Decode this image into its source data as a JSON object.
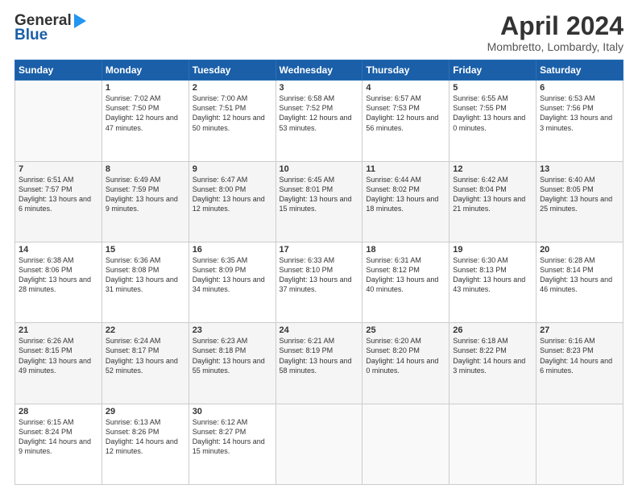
{
  "header": {
    "logo_general": "General",
    "logo_blue": "Blue",
    "month_title": "April 2024",
    "location": "Mombretto, Lombardy, Italy"
  },
  "weekdays": [
    "Sunday",
    "Monday",
    "Tuesday",
    "Wednesday",
    "Thursday",
    "Friday",
    "Saturday"
  ],
  "weeks": [
    [
      {
        "day": "",
        "sunrise": "",
        "sunset": "",
        "daylight": ""
      },
      {
        "day": "1",
        "sunrise": "Sunrise: 7:02 AM",
        "sunset": "Sunset: 7:50 PM",
        "daylight": "Daylight: 12 hours and 47 minutes."
      },
      {
        "day": "2",
        "sunrise": "Sunrise: 7:00 AM",
        "sunset": "Sunset: 7:51 PM",
        "daylight": "Daylight: 12 hours and 50 minutes."
      },
      {
        "day": "3",
        "sunrise": "Sunrise: 6:58 AM",
        "sunset": "Sunset: 7:52 PM",
        "daylight": "Daylight: 12 hours and 53 minutes."
      },
      {
        "day": "4",
        "sunrise": "Sunrise: 6:57 AM",
        "sunset": "Sunset: 7:53 PM",
        "daylight": "Daylight: 12 hours and 56 minutes."
      },
      {
        "day": "5",
        "sunrise": "Sunrise: 6:55 AM",
        "sunset": "Sunset: 7:55 PM",
        "daylight": "Daylight: 13 hours and 0 minutes."
      },
      {
        "day": "6",
        "sunrise": "Sunrise: 6:53 AM",
        "sunset": "Sunset: 7:56 PM",
        "daylight": "Daylight: 13 hours and 3 minutes."
      }
    ],
    [
      {
        "day": "7",
        "sunrise": "Sunrise: 6:51 AM",
        "sunset": "Sunset: 7:57 PM",
        "daylight": "Daylight: 13 hours and 6 minutes."
      },
      {
        "day": "8",
        "sunrise": "Sunrise: 6:49 AM",
        "sunset": "Sunset: 7:59 PM",
        "daylight": "Daylight: 13 hours and 9 minutes."
      },
      {
        "day": "9",
        "sunrise": "Sunrise: 6:47 AM",
        "sunset": "Sunset: 8:00 PM",
        "daylight": "Daylight: 13 hours and 12 minutes."
      },
      {
        "day": "10",
        "sunrise": "Sunrise: 6:45 AM",
        "sunset": "Sunset: 8:01 PM",
        "daylight": "Daylight: 13 hours and 15 minutes."
      },
      {
        "day": "11",
        "sunrise": "Sunrise: 6:44 AM",
        "sunset": "Sunset: 8:02 PM",
        "daylight": "Daylight: 13 hours and 18 minutes."
      },
      {
        "day": "12",
        "sunrise": "Sunrise: 6:42 AM",
        "sunset": "Sunset: 8:04 PM",
        "daylight": "Daylight: 13 hours and 21 minutes."
      },
      {
        "day": "13",
        "sunrise": "Sunrise: 6:40 AM",
        "sunset": "Sunset: 8:05 PM",
        "daylight": "Daylight: 13 hours and 25 minutes."
      }
    ],
    [
      {
        "day": "14",
        "sunrise": "Sunrise: 6:38 AM",
        "sunset": "Sunset: 8:06 PM",
        "daylight": "Daylight: 13 hours and 28 minutes."
      },
      {
        "day": "15",
        "sunrise": "Sunrise: 6:36 AM",
        "sunset": "Sunset: 8:08 PM",
        "daylight": "Daylight: 13 hours and 31 minutes."
      },
      {
        "day": "16",
        "sunrise": "Sunrise: 6:35 AM",
        "sunset": "Sunset: 8:09 PM",
        "daylight": "Daylight: 13 hours and 34 minutes."
      },
      {
        "day": "17",
        "sunrise": "Sunrise: 6:33 AM",
        "sunset": "Sunset: 8:10 PM",
        "daylight": "Daylight: 13 hours and 37 minutes."
      },
      {
        "day": "18",
        "sunrise": "Sunrise: 6:31 AM",
        "sunset": "Sunset: 8:12 PM",
        "daylight": "Daylight: 13 hours and 40 minutes."
      },
      {
        "day": "19",
        "sunrise": "Sunrise: 6:30 AM",
        "sunset": "Sunset: 8:13 PM",
        "daylight": "Daylight: 13 hours and 43 minutes."
      },
      {
        "day": "20",
        "sunrise": "Sunrise: 6:28 AM",
        "sunset": "Sunset: 8:14 PM",
        "daylight": "Daylight: 13 hours and 46 minutes."
      }
    ],
    [
      {
        "day": "21",
        "sunrise": "Sunrise: 6:26 AM",
        "sunset": "Sunset: 8:15 PM",
        "daylight": "Daylight: 13 hours and 49 minutes."
      },
      {
        "day": "22",
        "sunrise": "Sunrise: 6:24 AM",
        "sunset": "Sunset: 8:17 PM",
        "daylight": "Daylight: 13 hours and 52 minutes."
      },
      {
        "day": "23",
        "sunrise": "Sunrise: 6:23 AM",
        "sunset": "Sunset: 8:18 PM",
        "daylight": "Daylight: 13 hours and 55 minutes."
      },
      {
        "day": "24",
        "sunrise": "Sunrise: 6:21 AM",
        "sunset": "Sunset: 8:19 PM",
        "daylight": "Daylight: 13 hours and 58 minutes."
      },
      {
        "day": "25",
        "sunrise": "Sunrise: 6:20 AM",
        "sunset": "Sunset: 8:20 PM",
        "daylight": "Daylight: 14 hours and 0 minutes."
      },
      {
        "day": "26",
        "sunrise": "Sunrise: 6:18 AM",
        "sunset": "Sunset: 8:22 PM",
        "daylight": "Daylight: 14 hours and 3 minutes."
      },
      {
        "day": "27",
        "sunrise": "Sunrise: 6:16 AM",
        "sunset": "Sunset: 8:23 PM",
        "daylight": "Daylight: 14 hours and 6 minutes."
      }
    ],
    [
      {
        "day": "28",
        "sunrise": "Sunrise: 6:15 AM",
        "sunset": "Sunset: 8:24 PM",
        "daylight": "Daylight: 14 hours and 9 minutes."
      },
      {
        "day": "29",
        "sunrise": "Sunrise: 6:13 AM",
        "sunset": "Sunset: 8:26 PM",
        "daylight": "Daylight: 14 hours and 12 minutes."
      },
      {
        "day": "30",
        "sunrise": "Sunrise: 6:12 AM",
        "sunset": "Sunset: 8:27 PM",
        "daylight": "Daylight: 14 hours and 15 minutes."
      },
      {
        "day": "",
        "sunrise": "",
        "sunset": "",
        "daylight": ""
      },
      {
        "day": "",
        "sunrise": "",
        "sunset": "",
        "daylight": ""
      },
      {
        "day": "",
        "sunrise": "",
        "sunset": "",
        "daylight": ""
      },
      {
        "day": "",
        "sunrise": "",
        "sunset": "",
        "daylight": ""
      }
    ]
  ]
}
